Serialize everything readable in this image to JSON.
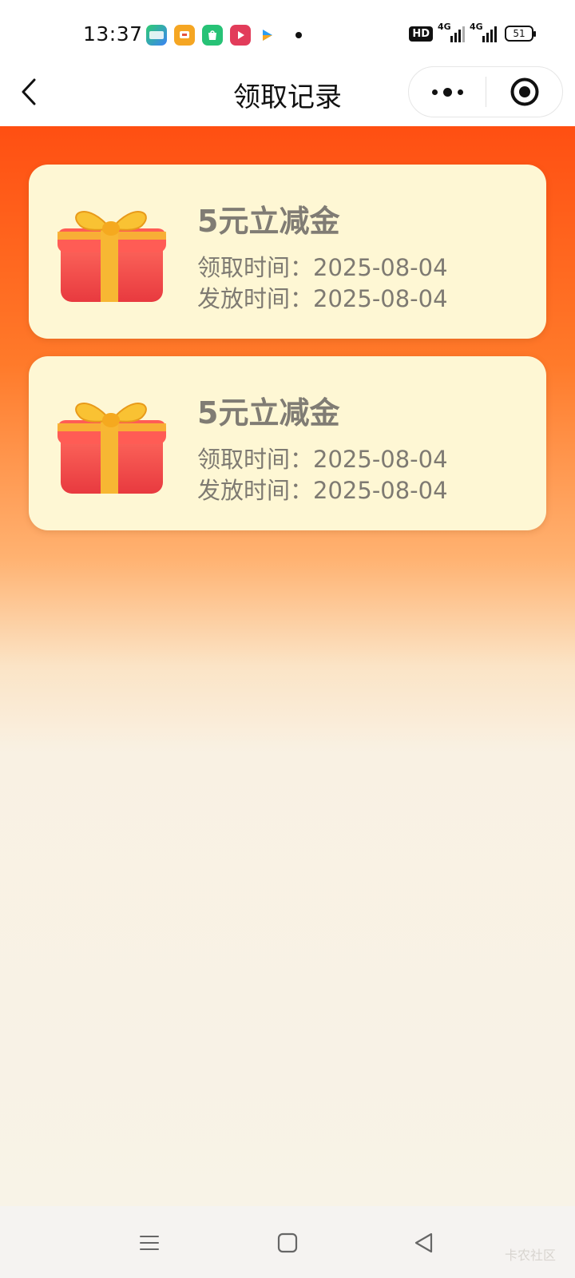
{
  "status_bar": {
    "time": "13:37",
    "app_icons": [
      "iqiyi-app-icon",
      "video-app-icon",
      "shopping-bag-app-icon",
      "play-app-icon",
      "arrow-app-icon"
    ],
    "hd_label": "HD",
    "signal_1_label": "4G",
    "signal_2_label": "4G",
    "battery_level": "51"
  },
  "nav": {
    "title": "领取记录",
    "back_icon": "chevron-left-icon",
    "more_icon": "more-dots-icon",
    "close_icon": "target-close-icon"
  },
  "records": [
    {
      "title": "5元立减金",
      "claim_label": "领取时间：",
      "claim_date": "2025-08-04",
      "issue_label": "发放时间：",
      "issue_date": "2025-08-04",
      "icon": "gift-box-icon"
    },
    {
      "title": "5元立减金",
      "claim_label": "领取时间：",
      "claim_date": "2025-08-04",
      "issue_label": "发放时间：",
      "issue_date": "2025-08-04",
      "icon": "gift-box-icon"
    }
  ],
  "system_nav": {
    "menu_icon": "menu-lines-icon",
    "home_icon": "square-home-icon",
    "back_icon": "triangle-back-icon",
    "watermark": "卡农社区"
  },
  "colors": {
    "header_orange": "#ff4f12",
    "card_bg": "#fef7d4",
    "card_text": "#7e7a72",
    "page_bg": "#f8f3e7"
  }
}
